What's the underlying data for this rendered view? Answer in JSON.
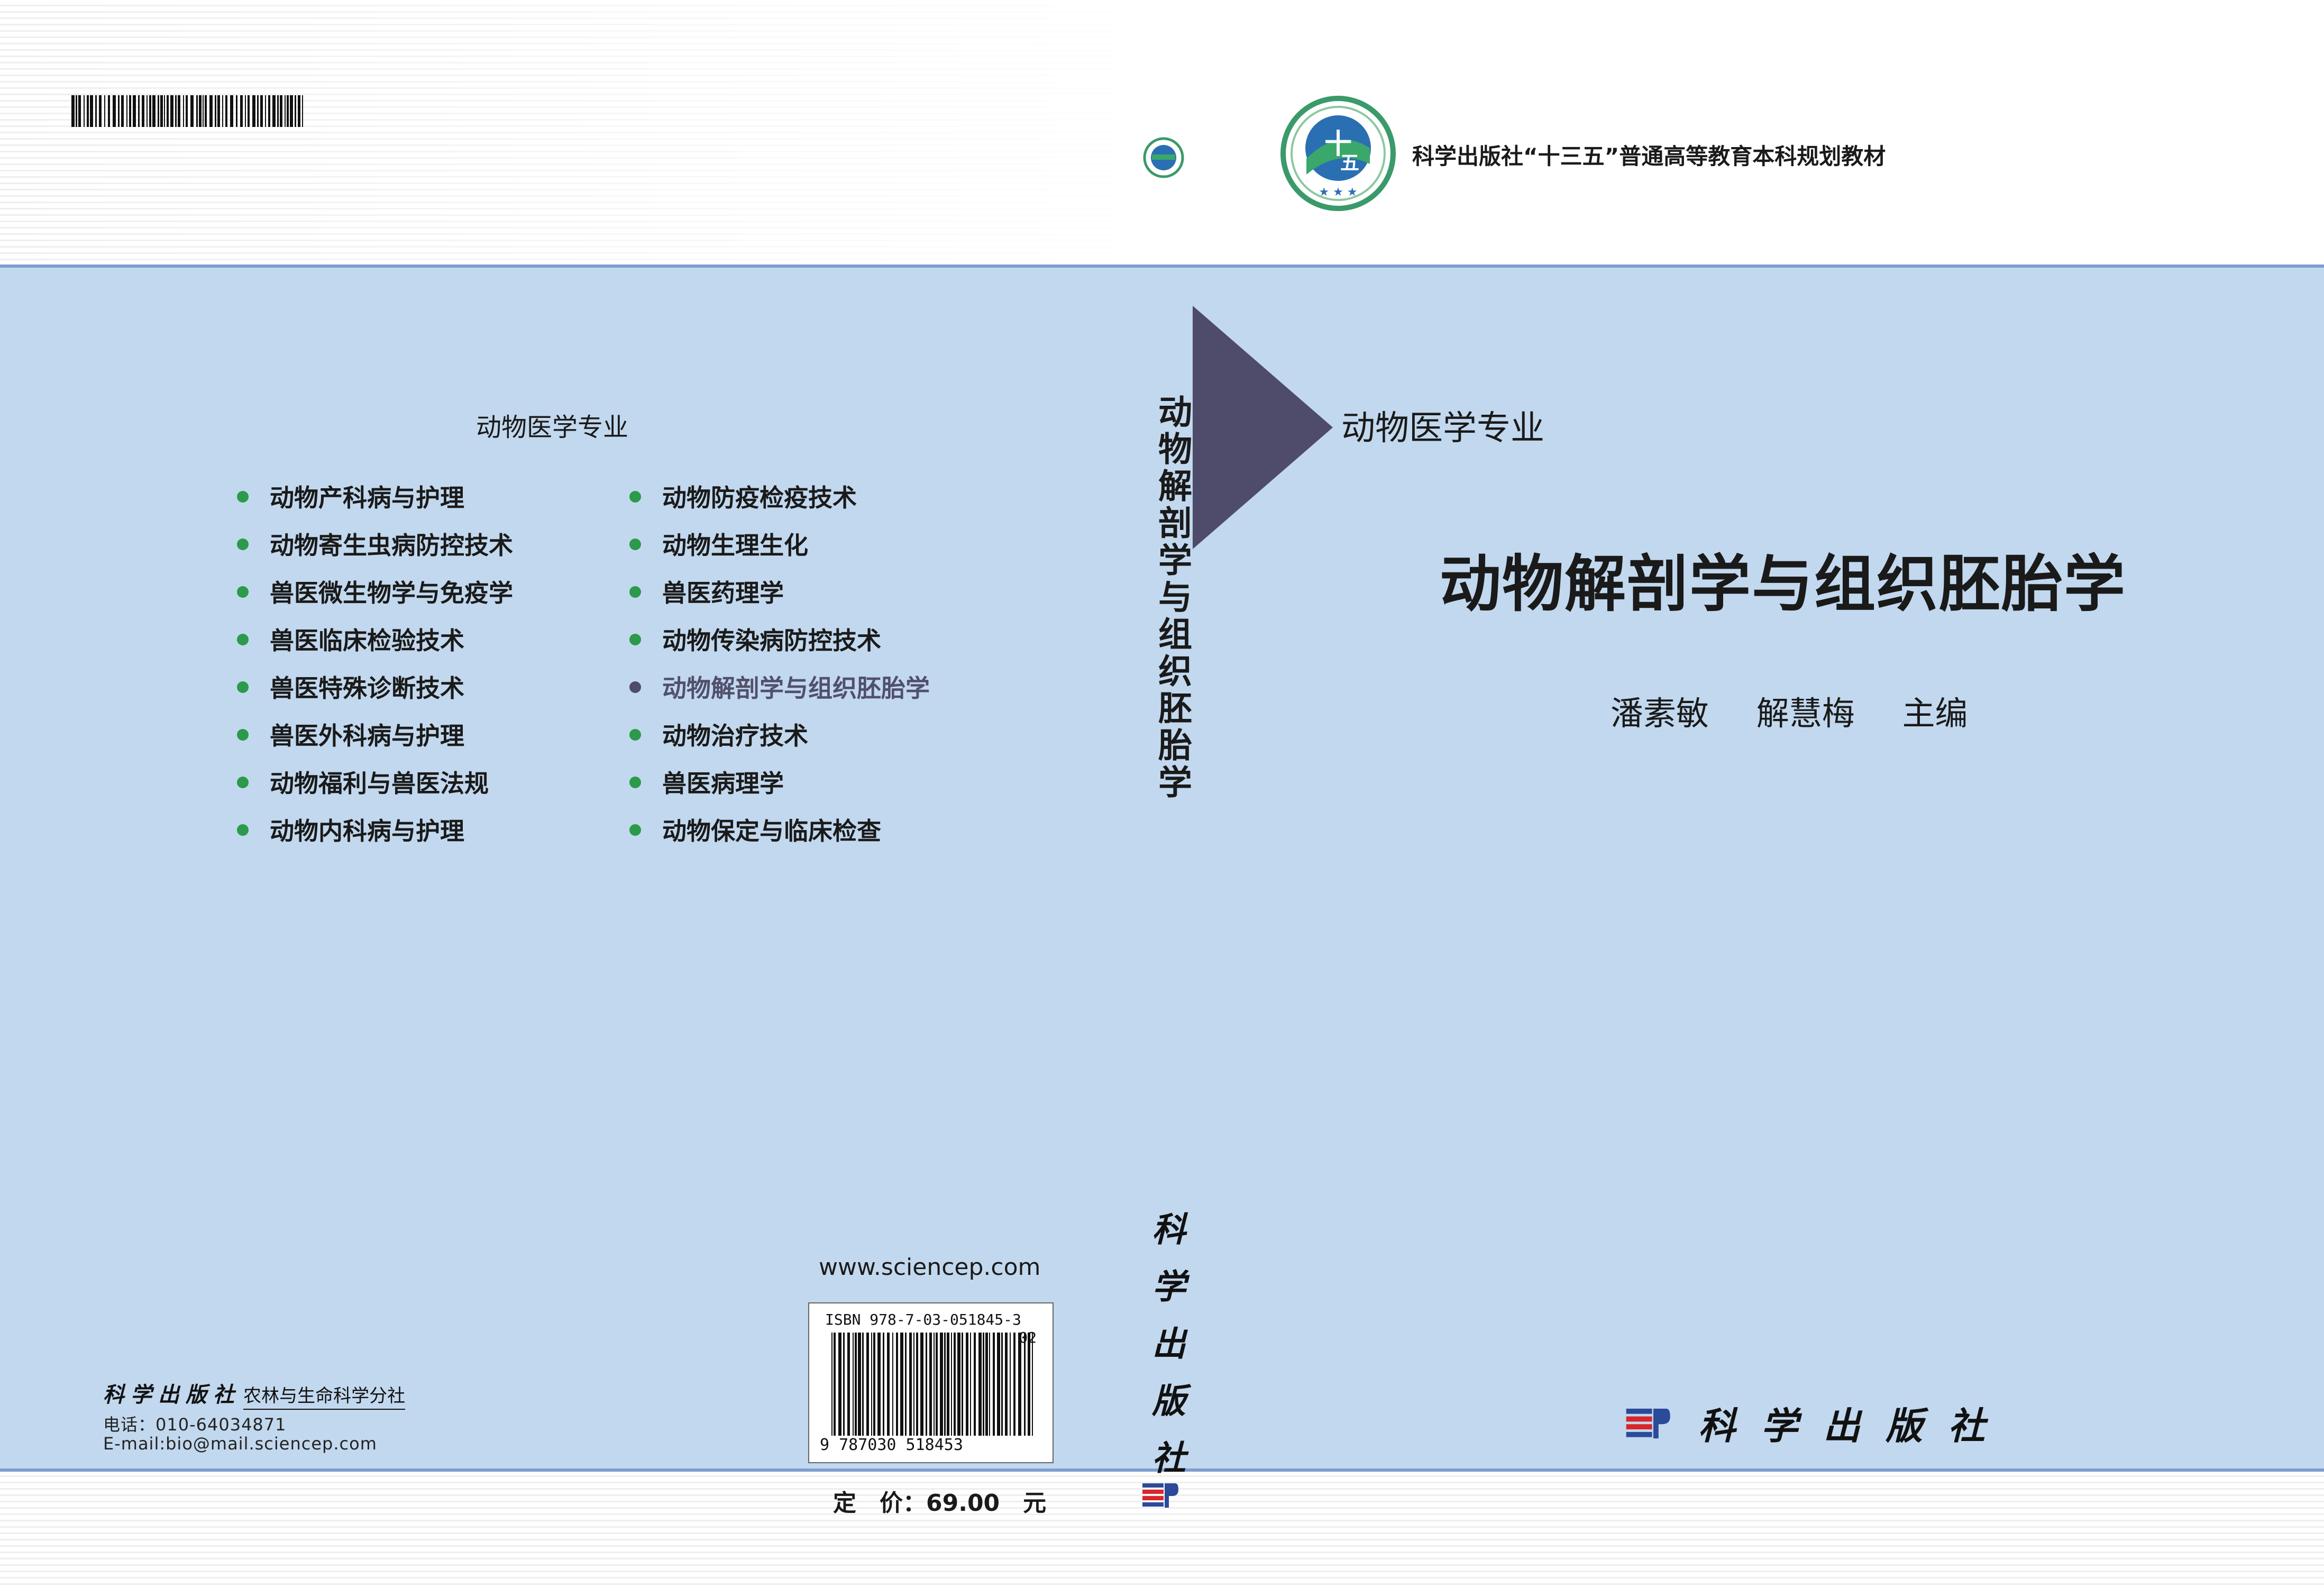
{
  "top_band": {
    "series_line": "科学出版社“十三五”普通高等教育本科规划教材",
    "logo_icon": "thirteenth-five-year-plan-emblem"
  },
  "back_cover": {
    "heading": "动物医学专业",
    "left_column": [
      "动物产科病与护理",
      "动物寄生虫病防控技术",
      "兽医微生物学与免疫学",
      "兽医临床检验技术",
      "兽医特殊诊断技术",
      "兽医外科病与护理",
      "动物福利与兽医法规",
      "动物内科病与护理"
    ],
    "right_column": [
      "动物防疫检疫技术",
      "动物生理生化",
      "兽医药理学",
      "动物传染病防控技术",
      "动物解剖学与组织胚胎学",
      "动物治疗技术",
      "兽医病理学",
      "动物保定与临床检查"
    ],
    "current_index_right": 4,
    "website": "www.sciencep.com",
    "isbn_label": "ISBN 978-7-03-051845-3",
    "isbn_addon": "02",
    "isbn_digits": "9 787030 518453",
    "price": "定　价：69.00　元",
    "publisher_calli": "科学出版社",
    "publisher_branch": "农林与生命科学分社",
    "phone": "电话：010-64034871",
    "email": "E-mail:bio@mail.sciencep.com"
  },
  "spine": {
    "title": "动物解剖学与组织胚胎学",
    "publisher": "科学出版社"
  },
  "front_cover": {
    "series": "动物医学专业",
    "title": "动物解剖学与组织胚胎学",
    "author1": "潘素敏",
    "author2": "解慧梅",
    "role": "主编",
    "publisher": "科学出版社"
  },
  "colors": {
    "cover_blue": "#c2d8ee",
    "rule_blue": "#7f9ed0",
    "triangle": "#4e4c6a",
    "bullet_green": "#2b9a4a",
    "publisher_red": "#d8262b"
  }
}
